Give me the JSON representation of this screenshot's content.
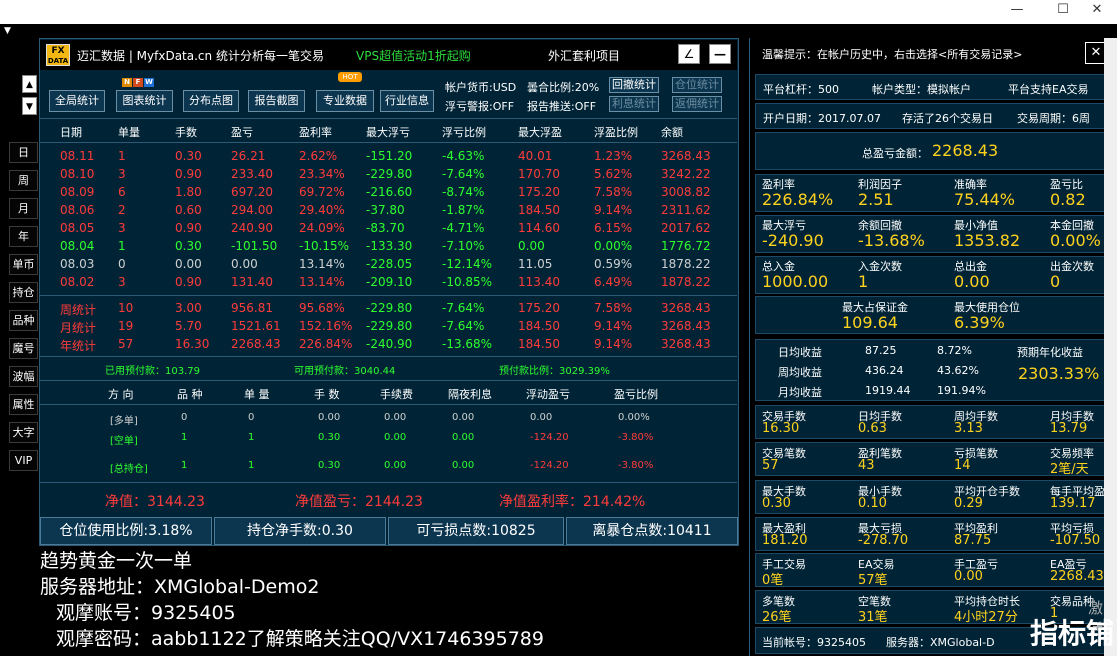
{
  "window": {
    "minimize": "—",
    "maximize": "☐",
    "close": "✕"
  },
  "top_dropdown": "▼",
  "brand": {
    "logo_top": "FX",
    "logo_bottom": "DATA",
    "name": "迈汇数据 | MyfxData.cn  统计分析每一笔交易",
    "promo": "VPS超值活动1折起购",
    "forex": "外汇套利项目",
    "edit_btn": "∠",
    "min_btn": "—"
  },
  "sidebar": {
    "up": "▲",
    "down": "▼",
    "buttons": [
      "日",
      "周",
      "月",
      "年",
      "单币",
      "持仓",
      "品种",
      "魔号",
      "波幅",
      "属性",
      "大字",
      "VIP"
    ]
  },
  "toolbar": {
    "buttons": [
      "全局统计",
      "图表统计",
      "分布点图",
      "报告截图",
      "专业数据",
      "行业信息"
    ],
    "nfw": [
      "N",
      "F",
      "W"
    ],
    "nfw_colors": [
      "#e08a00",
      "#d24b1e",
      "#1e6fd2"
    ],
    "hot": "HOT",
    "currency": "帐户货币:USD",
    "ratio": "曇合比例:20%",
    "float_alert": "浮亏警报:OFF",
    "report_push": "报告推送:OFF",
    "right_buttons": [
      "回撤统计",
      "仓位统计",
      "利息统计",
      "返佣统计"
    ]
  },
  "trade_table": {
    "headers": [
      "日期",
      "单量",
      "手数",
      "盈亏",
      "盈利率",
      "最大浮亏",
      "浮亏比例",
      "最大浮盈",
      "浮盈比例",
      "余额"
    ],
    "rows": [
      {
        "c": "red",
        "v": [
          "08.11",
          "1",
          "0.30",
          "26.21",
          "2.62%",
          "-151.20",
          "-4.63%",
          "40.01",
          "1.23%",
          "3268.43"
        ]
      },
      {
        "c": "red",
        "v": [
          "08.10",
          "3",
          "0.90",
          "233.40",
          "23.34%",
          "-229.80",
          "-7.64%",
          "170.70",
          "5.62%",
          "3242.22"
        ]
      },
      {
        "c": "red",
        "v": [
          "08.09",
          "6",
          "1.80",
          "697.20",
          "69.72%",
          "-216.60",
          "-8.74%",
          "175.20",
          "7.58%",
          "3008.82"
        ]
      },
      {
        "c": "red",
        "v": [
          "08.06",
          "2",
          "0.60",
          "294.00",
          "29.40%",
          "-37.80",
          "-1.87%",
          "184.50",
          "9.14%",
          "2311.62"
        ]
      },
      {
        "c": "red",
        "v": [
          "08.05",
          "3",
          "0.90",
          "240.90",
          "24.09%",
          "-83.70",
          "-4.71%",
          "114.60",
          "6.15%",
          "2017.62"
        ]
      },
      {
        "c": "green",
        "v": [
          "08.04",
          "1",
          "0.30",
          "-101.50",
          "-10.15%",
          "-133.30",
          "-7.10%",
          "0.00",
          "0.00%",
          "1776.72"
        ]
      },
      {
        "c": "gray",
        "v": [
          "08.03",
          "0",
          "0.00",
          "0.00",
          "13.14%",
          "-228.05",
          "-12.14%",
          "11.05",
          "0.59%",
          "1878.22"
        ]
      },
      {
        "c": "red",
        "v": [
          "08.02",
          "3",
          "0.90",
          "131.40",
          "13.14%",
          "-209.10",
          "-10.85%",
          "113.40",
          "6.49%",
          "1878.22"
        ]
      }
    ],
    "summary": [
      [
        "周统计",
        "10",
        "3.00",
        "956.81",
        "95.68%",
        "-229.80",
        "-7.64%",
        "175.20",
        "7.58%",
        "3268.43"
      ],
      [
        "月统计",
        "19",
        "5.70",
        "1521.61",
        "152.16%",
        "-229.80",
        "-7.64%",
        "184.50",
        "9.14%",
        "3268.43"
      ],
      [
        "年统计",
        "57",
        "16.30",
        "2268.43",
        "226.84%",
        "-240.90",
        "-13.68%",
        "184.50",
        "9.14%",
        "3268.43"
      ]
    ]
  },
  "margin": {
    "used": "已用预付款：103.79",
    "available": "可用预付款：3040.44",
    "ratio": "预付款比例：3029.39%"
  },
  "position_table": {
    "headers": [
      "方 向",
      "品 种",
      "单 量",
      "手 数",
      "手续费",
      "隔夜利息",
      "浮动盈亏",
      "盈亏比例"
    ],
    "rows": [
      [
        "[多单]",
        "0",
        "0",
        "0.00",
        "0.00",
        "0.00",
        "0.00",
        "0.00%"
      ],
      [
        "[空单]",
        "1",
        "1",
        "0.30",
        "0.00",
        "0.00",
        "-124.20",
        "-3.80%"
      ],
      [
        "[总持仓]",
        "1",
        "1",
        "0.30",
        "0.00",
        "0.00",
        "-124.20",
        "-3.80%"
      ]
    ]
  },
  "net": {
    "value": "净值：3144.23",
    "profit": "净值盈亏：2144.23",
    "rate": "净值盈利率：214.42%"
  },
  "bottom_bar": [
    "仓位使用比例:3.18%",
    "持仓净手数:0.30",
    "可亏损点数:10825",
    "离暴仓点数:10411"
  ],
  "overlay_text": [
    "趋势黄金一次一单",
    "服务器地址：XMGlobal-Demo2",
    "观摩账号：9325405",
    "观摩密码：aabb1122了解策略关注QQ/VX1746395789"
  ],
  "right": {
    "tip": "温馨提示：在帐户历史中，右击选择<所有交易记录>",
    "close": "✕",
    "leverage": "平台杠杆：500",
    "account_type": "帐户类型：模拟帐户",
    "ea_support": "平台支持EA交易",
    "open_date": "开户日期：2017.07.07",
    "trade_days": "存活了26个交易日",
    "trade_cycle": "交易周期：6周",
    "total_profit_label": "总盈亏金额：",
    "total_profit": "2268.43",
    "stats1": [
      {
        "l": "盈利率",
        "v": "226.84%"
      },
      {
        "l": "利润因子",
        "v": "2.51"
      },
      {
        "l": "准确率",
        "v": "75.44%"
      },
      {
        "l": "盈亏比",
        "v": "0.82"
      }
    ],
    "stats2": [
      {
        "l": "最大浮亏",
        "v": "-240.90"
      },
      {
        "l": "余额回撤",
        "v": "-13.68%"
      },
      {
        "l": "最小净值",
        "v": "1353.82"
      },
      {
        "l": "本金回撤",
        "v": "0.00%"
      }
    ],
    "stats3": [
      {
        "l": "总入金",
        "v": "1000.00"
      },
      {
        "l": "入金次数",
        "v": "1"
      },
      {
        "l": "总出金",
        "v": "0.00"
      },
      {
        "l": "出金次数",
        "v": "0"
      }
    ],
    "stats4": [
      {
        "l": "最大占保证金",
        "v": "109.64"
      },
      {
        "l": "最大使用仓位",
        "v": "6.39%"
      }
    ],
    "earnings": [
      [
        "日均收益",
        "87.25",
        "8.72%"
      ],
      [
        "周均收益",
        "436.24",
        "43.62%"
      ],
      [
        "月均收益",
        "1919.44",
        "191.94%"
      ]
    ],
    "annual_label": "预期年化收益",
    "annual_value": "2303.33%",
    "grid": [
      [
        {
          "l": "交易手数",
          "v": "16.30"
        },
        {
          "l": "日均手数",
          "v": "0.63"
        },
        {
          "l": "周均手数",
          "v": "3.13"
        },
        {
          "l": "月均手数",
          "v": "13.79"
        }
      ],
      [
        {
          "l": "交易笔数",
          "v": "57"
        },
        {
          "l": "盈利笔数",
          "v": "43"
        },
        {
          "l": "亏损笔数",
          "v": "14"
        },
        {
          "l": "交易频率",
          "v": "2笔/天"
        }
      ],
      [
        {
          "l": "最大手数",
          "v": "0.30"
        },
        {
          "l": "最小手数",
          "v": "0.10"
        },
        {
          "l": "平均开仓手数",
          "v": "0.29"
        },
        {
          "l": "每手平均盈亏",
          "v": "139.17"
        }
      ],
      [
        {
          "l": "最大盈利",
          "v": "181.20"
        },
        {
          "l": "最大亏损",
          "v": "-278.70"
        },
        {
          "l": "平均盈利",
          "v": "87.75"
        },
        {
          "l": "平均亏损",
          "v": "-107.50"
        }
      ],
      [
        {
          "l": "手工交易",
          "v": "0笔"
        },
        {
          "l": "EA交易",
          "v": "57笔"
        },
        {
          "l": "手工盈亏",
          "v": "0.00"
        },
        {
          "l": "EA盈亏",
          "v": "2268.43"
        }
      ],
      [
        {
          "l": "多笔数",
          "v": "26笔"
        },
        {
          "l": "空笔数",
          "v": "31笔"
        },
        {
          "l": "平均持仓时长",
          "v": "4小时27分"
        },
        {
          "l": "交易品种",
          "v": "1"
        }
      ]
    ],
    "current_account": "当前帐号：9325405",
    "server": "服务器：XMGlobal-D"
  },
  "watermark": "指标铺",
  "watermark_small": "激活"
}
